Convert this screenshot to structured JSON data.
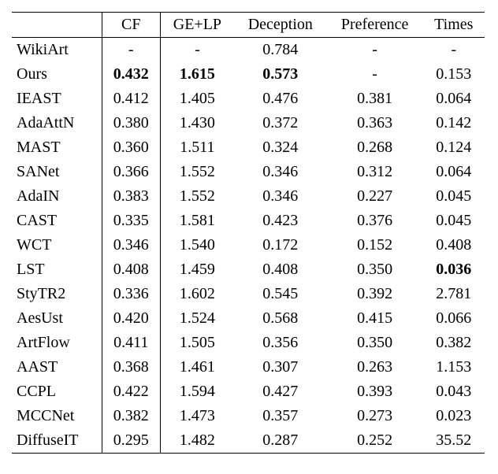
{
  "chart_data": {
    "type": "table",
    "columns": [
      "",
      "CF",
      "GE+LP",
      "Deception",
      "Preference",
      "Times"
    ],
    "rows": [
      {
        "name": "WikiArt",
        "cf": "-",
        "gelp": "-",
        "deception": "0.784",
        "preference": "-",
        "times": "-"
      },
      {
        "name": "Ours",
        "cf": "0.432",
        "gelp": "1.615",
        "deception": "0.573",
        "preference": "-",
        "times": "0.153"
      },
      {
        "name": "IEAST",
        "cf": "0.412",
        "gelp": "1.405",
        "deception": "0.476",
        "preference": "0.381",
        "times": "0.064"
      },
      {
        "name": "AdaAttN",
        "cf": "0.380",
        "gelp": "1.430",
        "deception": "0.372",
        "preference": "0.363",
        "times": "0.142"
      },
      {
        "name": "MAST",
        "cf": "0.360",
        "gelp": "1.511",
        "deception": "0.324",
        "preference": "0.268",
        "times": "0.124"
      },
      {
        "name": "SANet",
        "cf": "0.366",
        "gelp": "1.552",
        "deception": "0.346",
        "preference": "0.312",
        "times": "0.064"
      },
      {
        "name": "AdaIN",
        "cf": "0.383",
        "gelp": "1.552",
        "deception": "0.346",
        "preference": "0.227",
        "times": "0.045"
      },
      {
        "name": "CAST",
        "cf": "0.335",
        "gelp": "1.581",
        "deception": "0.423",
        "preference": "0.376",
        "times": "0.045"
      },
      {
        "name": "WCT",
        "cf": "0.346",
        "gelp": "1.540",
        "deception": "0.172",
        "preference": "0.152",
        "times": "0.408"
      },
      {
        "name": "LST",
        "cf": "0.408",
        "gelp": "1.459",
        "deception": "0.408",
        "preference": "0.350",
        "times": "0.036"
      },
      {
        "name": "StyTR2",
        "cf": "0.336",
        "gelp": "1.602",
        "deception": "0.545",
        "preference": "0.392",
        "times": "2.781"
      },
      {
        "name": "AesUst",
        "cf": "0.420",
        "gelp": "1.524",
        "deception": "0.568",
        "preference": "0.415",
        "times": "0.066"
      },
      {
        "name": "ArtFlow",
        "cf": "0.411",
        "gelp": "1.505",
        "deception": "0.356",
        "preference": "0.350",
        "times": "0.382"
      },
      {
        "name": "AAST",
        "cf": "0.368",
        "gelp": "1.461",
        "deception": "0.307",
        "preference": "0.263",
        "times": "1.153"
      },
      {
        "name": "CCPL",
        "cf": "0.422",
        "gelp": "1.594",
        "deception": "0.427",
        "preference": "0.393",
        "times": "0.043"
      },
      {
        "name": "MCCNet",
        "cf": "0.382",
        "gelp": "1.473",
        "deception": "0.357",
        "preference": "0.273",
        "times": "0.023"
      },
      {
        "name": "DiffuseIT",
        "cf": "0.295",
        "gelp": "1.482",
        "deception": "0.287",
        "preference": "0.252",
        "times": "35.52"
      }
    ],
    "bold_cells": {
      "Ours": [
        "cf",
        "gelp",
        "deception"
      ],
      "LST": [
        "times"
      ]
    }
  }
}
